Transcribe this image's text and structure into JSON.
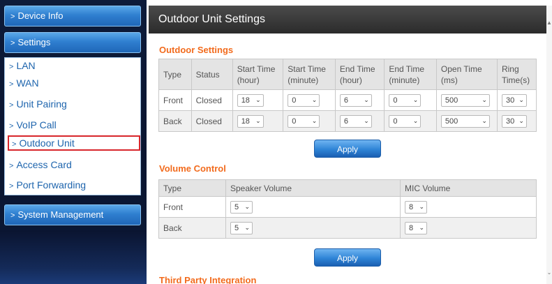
{
  "sidebar": {
    "device_info": "Device Info",
    "settings": "Settings",
    "items": [
      "LAN",
      "WAN",
      "Unit Pairing",
      "VoIP Call",
      "Outdoor Unit",
      "Access Card",
      "Port Forwarding"
    ],
    "system_management": "System Management",
    "active_item": "Outdoor Unit"
  },
  "main": {
    "title": "Outdoor Unit Settings",
    "outdoor_settings": {
      "title": "Outdoor Settings",
      "headers": [
        "Type",
        "Status",
        "Start Time (hour)",
        "Start Time (minute)",
        "End Time (hour)",
        "End Time (minute)",
        "Open Time (ms)",
        "Ring Time(s)"
      ],
      "rows": [
        {
          "type": "Front",
          "status": "Closed",
          "start_hour": "18",
          "start_minute": "0",
          "end_hour": "6",
          "end_minute": "0",
          "open_time": "500",
          "ring_time": "30"
        },
        {
          "type": "Back",
          "status": "Closed",
          "start_hour": "18",
          "start_minute": "0",
          "end_hour": "6",
          "end_minute": "0",
          "open_time": "500",
          "ring_time": "30"
        }
      ],
      "apply_label": "Apply"
    },
    "volume_control": {
      "title": "Volume Control",
      "headers": [
        "Type",
        "Speaker Volume",
        "MIC Volume"
      ],
      "rows": [
        {
          "type": "Front",
          "speaker": "5",
          "mic": "8"
        },
        {
          "type": "Back",
          "speaker": "5",
          "mic": "8"
        }
      ],
      "apply_label": "Apply"
    },
    "third_party": {
      "title": "Third Party Integration"
    }
  },
  "colors": {
    "accent_orange": "#f26b1d",
    "link_blue": "#1d64ad",
    "highlight_red": "#d8262b"
  }
}
